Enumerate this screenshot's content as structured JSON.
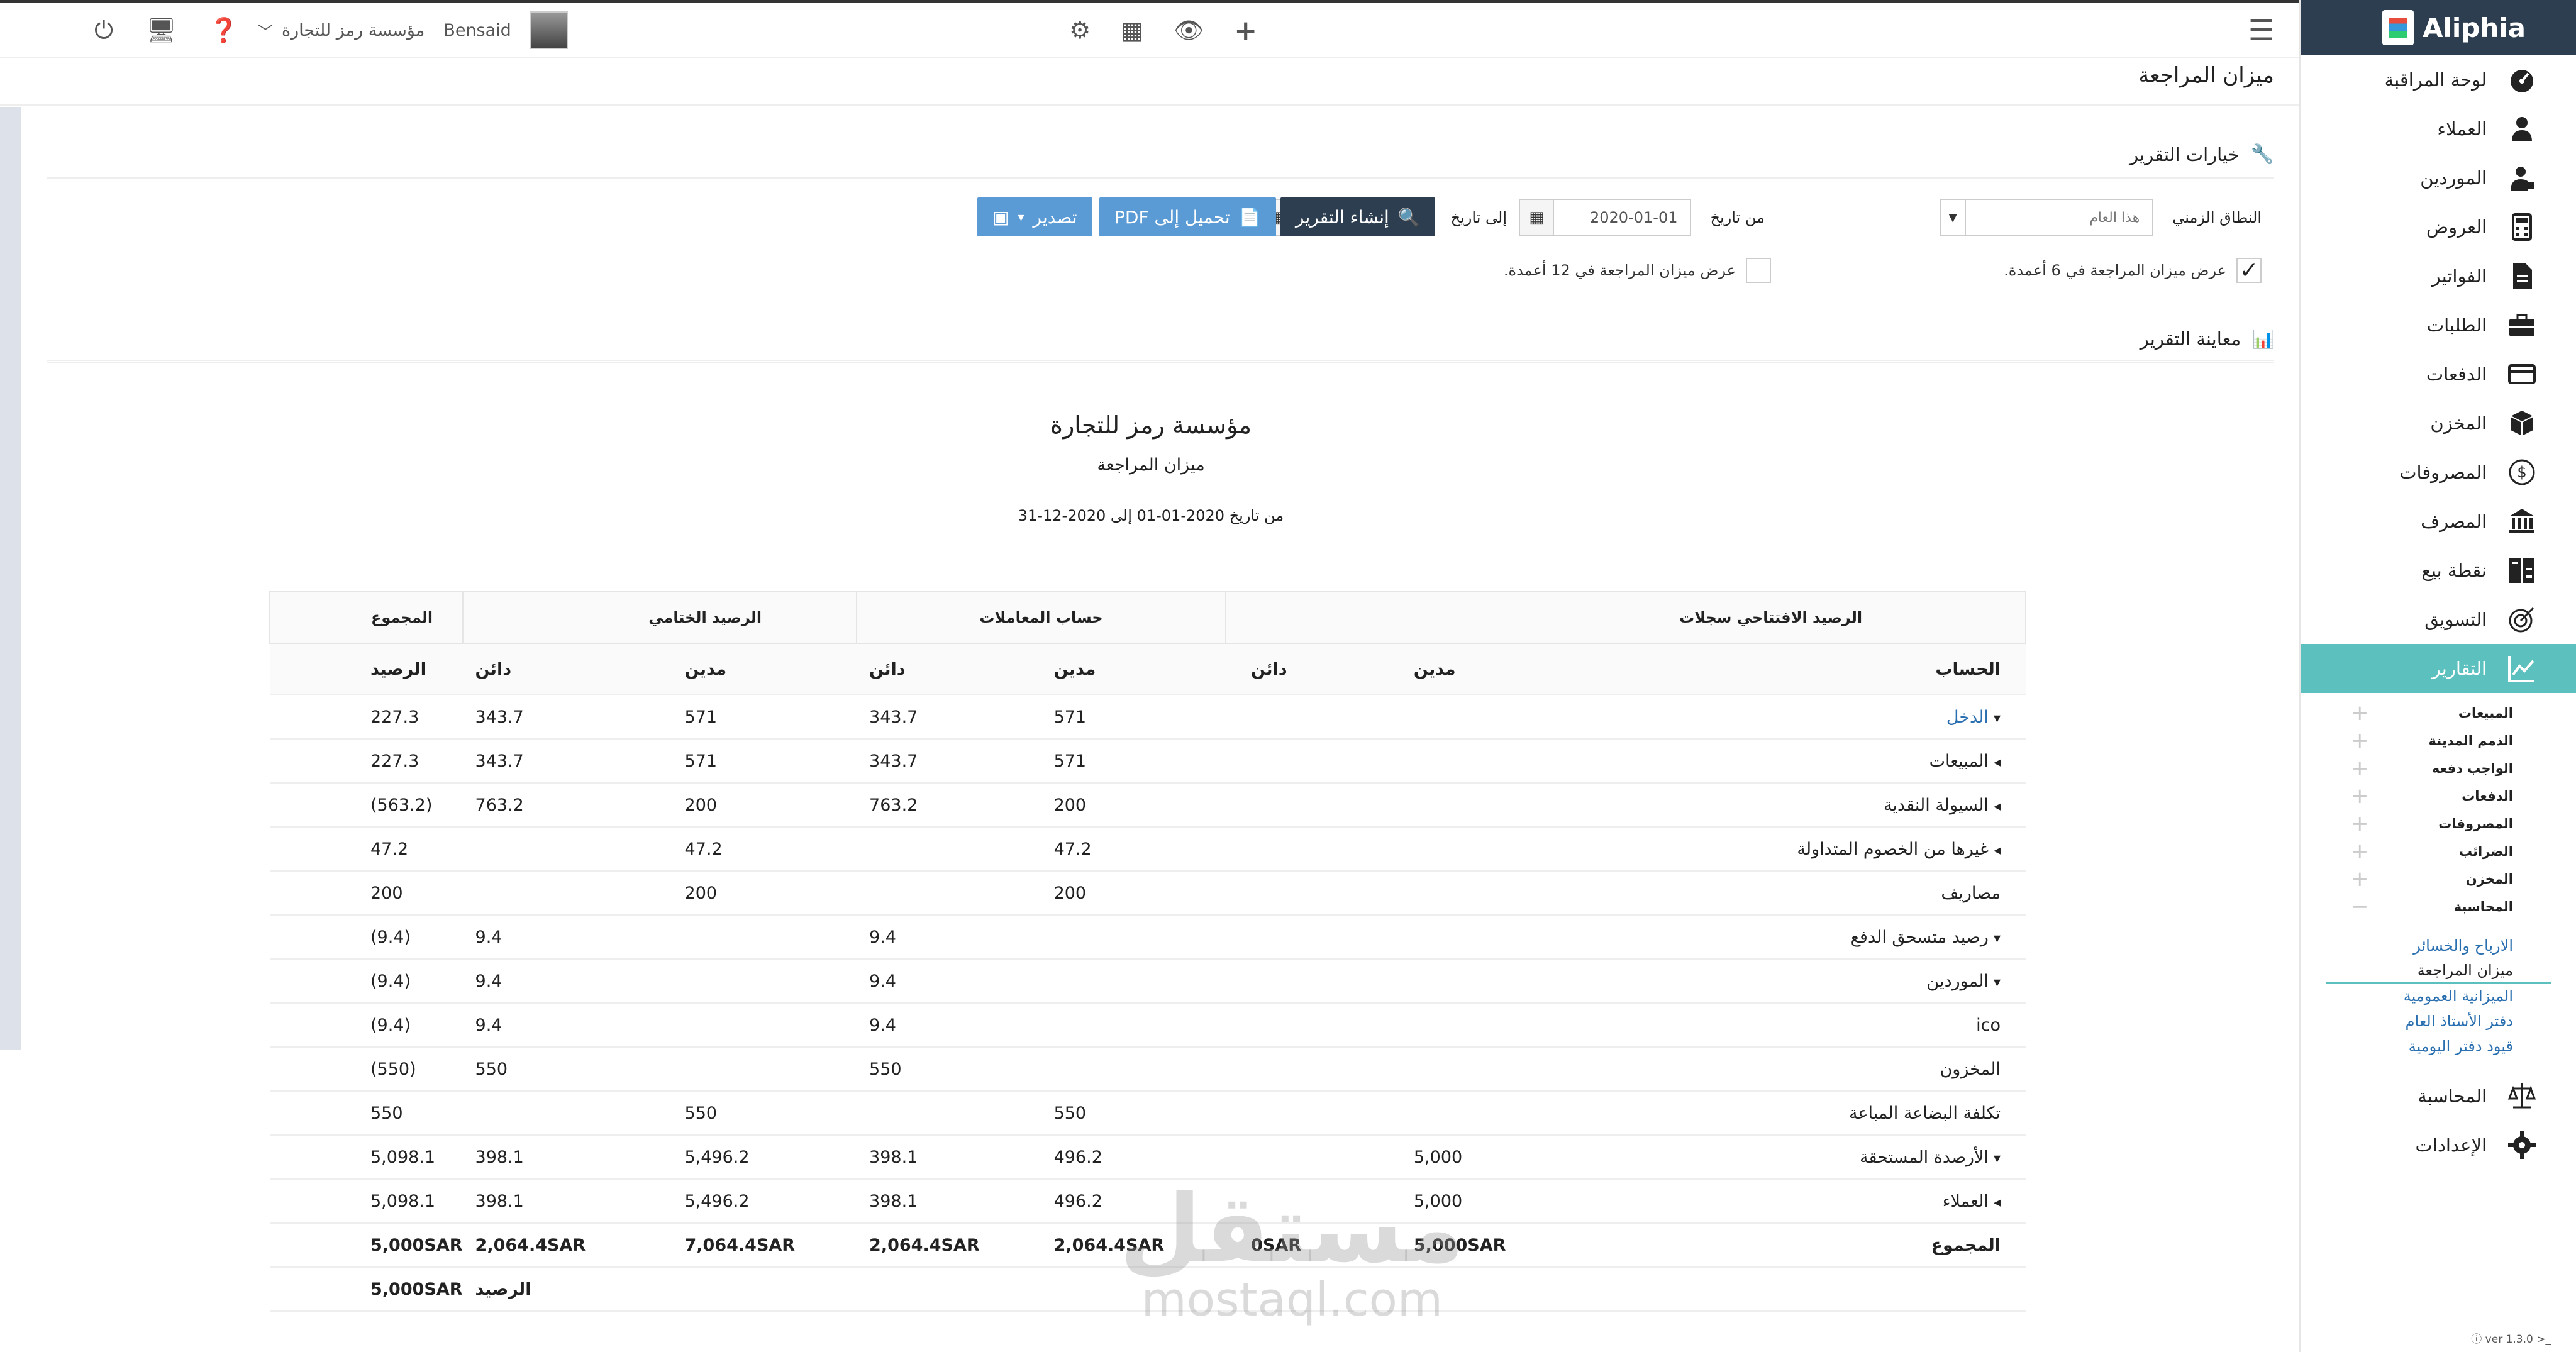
{
  "brand": {
    "name": "Aliphia"
  },
  "nav": [
    {
      "label": "لوحة المراقبة",
      "icon": "dashboard-icon"
    },
    {
      "label": "العملاء",
      "icon": "user-icon"
    },
    {
      "label": "الموردين",
      "icon": "supplier-icon"
    },
    {
      "label": "العروض",
      "icon": "calculator-icon"
    },
    {
      "label": "الفواتير",
      "icon": "invoice-icon"
    },
    {
      "label": "الطلبات",
      "icon": "briefcase-icon"
    },
    {
      "label": "الدفعات",
      "icon": "card-icon"
    },
    {
      "label": "المخزن",
      "icon": "box-icon"
    },
    {
      "label": "المصروفات",
      "icon": "dollar-icon"
    },
    {
      "label": "المصرف",
      "icon": "bank-icon"
    },
    {
      "label": "نقطة بيع",
      "icon": "pos-icon"
    },
    {
      "label": "التسويق",
      "icon": "target-icon"
    },
    {
      "label": "التقارير",
      "icon": "chart-icon"
    }
  ],
  "reports_sub": [
    "المبيعات",
    "الذمم المدينة",
    "الواجب دفعه",
    "الدفعات",
    "المصروفات",
    "الضرائب",
    "المخزن",
    "المحاسبة"
  ],
  "accounting_sub": [
    "الارباح والخسائر",
    "ميزان المراجعة",
    "الميزانية العمومية",
    "دفتر الأستاذ العام",
    "قيود دفتر اليومية"
  ],
  "nav_bottom": [
    {
      "label": "المحاسبة",
      "icon": "scale-icon"
    },
    {
      "label": "الإعدادات",
      "icon": "gear-icon"
    }
  ],
  "version": "ver 1.3.0",
  "topbar": {
    "user": "Bensaid",
    "company": "مؤسسة رمز للتجارة"
  },
  "page": {
    "title": "ميزان المراجعة"
  },
  "options": {
    "title": "خيارات التقرير",
    "range_label": "النطاق الزمني",
    "range_value": "هذا العام",
    "from_label": "من تاريخ",
    "from_value": "2020-01-01",
    "to_label": "إلى تاريخ",
    "to_value": "2020-12-31",
    "create_btn": "إنشاء التقرير",
    "pdf_btn": "تحميل إلى PDF",
    "export_btn": "تصدير",
    "check6": "عرض ميزان المراجعة في 6 أعمدة.",
    "check12": "عرض ميزان المراجعة في 12 أعمدة."
  },
  "preview": {
    "title": "معاينة التقرير",
    "company": "مؤسسة رمز للتجارة",
    "report": "ميزان المراجعة",
    "period": "من تاريخ 2020-01-01 إلى 2020-12-31"
  },
  "table": {
    "groups": {
      "opening": "الرصيد الافتتاحي سجلات",
      "transactions": "حساب المعاملات",
      "closing": "الرصيد الختامي",
      "total": "المجموع"
    },
    "cols": {
      "account": "الحساب",
      "debit": "مدين",
      "credit": "دائن",
      "balance": "الرصيد"
    },
    "rows": [
      {
        "account": "الدخل",
        "caret": "▾",
        "link": true,
        "od": "",
        "oc": "",
        "td": "571",
        "tc": "343.7",
        "cd": "571",
        "cc": "343.7",
        "bal": "227.3"
      },
      {
        "account": "المبيعات",
        "caret": "◂",
        "od": "",
        "oc": "",
        "td": "571",
        "tc": "343.7",
        "cd": "571",
        "cc": "343.7",
        "bal": "227.3"
      },
      {
        "account": "السيولة النقدية",
        "caret": "◂",
        "od": "",
        "oc": "",
        "td": "200",
        "tc": "763.2",
        "cd": "200",
        "cc": "763.2",
        "bal": "(563.2)"
      },
      {
        "account": "غيرها من الخصوم المتداولة",
        "caret": "◂",
        "od": "",
        "oc": "",
        "td": "47.2",
        "tc": "",
        "cd": "47.2",
        "cc": "",
        "bal": "47.2"
      },
      {
        "account": "مصاريف",
        "caret": "",
        "od": "",
        "oc": "",
        "td": "200",
        "tc": "",
        "cd": "200",
        "cc": "",
        "bal": "200"
      },
      {
        "account": "رصيد متسحق الدفع",
        "caret": "▾",
        "od": "",
        "oc": "",
        "td": "",
        "tc": "9.4",
        "cd": "",
        "cc": "9.4",
        "bal": "(9.4)"
      },
      {
        "account": "الموردين",
        "caret": "▾",
        "od": "",
        "oc": "",
        "td": "",
        "tc": "9.4",
        "cd": "",
        "cc": "9.4",
        "bal": "(9.4)"
      },
      {
        "account": "ico",
        "caret": "",
        "od": "",
        "oc": "",
        "td": "",
        "tc": "9.4",
        "cd": "",
        "cc": "9.4",
        "bal": "(9.4)"
      },
      {
        "account": "المخزون",
        "caret": "",
        "od": "",
        "oc": "",
        "td": "",
        "tc": "550",
        "cd": "",
        "cc": "550",
        "bal": "(550)"
      },
      {
        "account": "تكلفة البضاعة المباعة",
        "caret": "",
        "od": "",
        "oc": "",
        "td": "550",
        "tc": "",
        "cd": "550",
        "cc": "",
        "bal": "550"
      },
      {
        "account": "الأرصدة المستحقة",
        "caret": "▾",
        "od": "5,000",
        "oc": "",
        "td": "496.2",
        "tc": "398.1",
        "cd": "5,496.2",
        "cc": "398.1",
        "bal": "5,098.1"
      },
      {
        "account": "العملاء",
        "caret": "◂",
        "od": "5,000",
        "oc": "",
        "td": "496.2",
        "tc": "398.1",
        "cd": "5,496.2",
        "cc": "398.1",
        "bal": "5,098.1"
      }
    ],
    "total": {
      "account": "المجموع",
      "od": "5,000SAR",
      "oc": "0SAR",
      "td": "2,064.4SAR",
      "tc": "2,064.4SAR",
      "cd": "7,064.4SAR",
      "cc": "2,064.4SAR",
      "bal": "5,000SAR"
    },
    "balance_row": {
      "label": "الرصيد",
      "bal": "5,000SAR"
    }
  },
  "watermark": {
    "ar": "مستقل",
    "en": "mostaql.com"
  }
}
